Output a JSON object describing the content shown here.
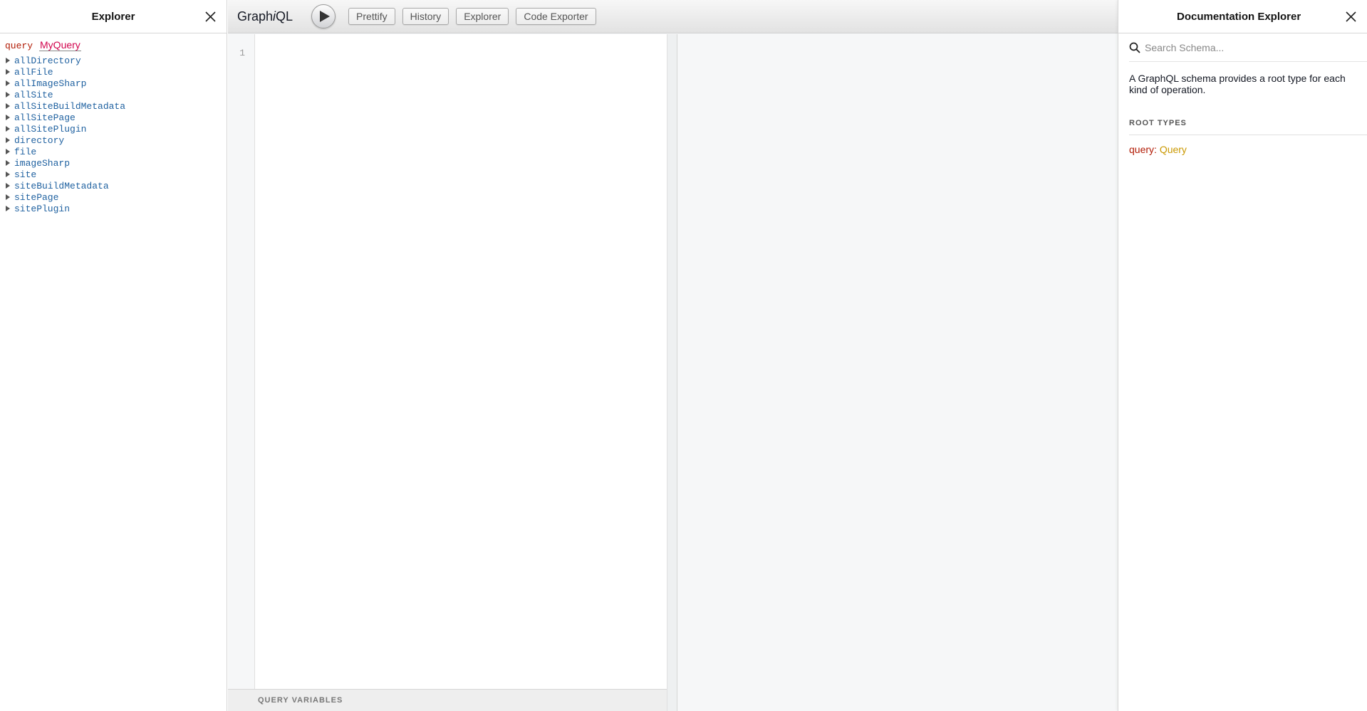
{
  "explorer": {
    "title": "Explorer",
    "operation": {
      "keyword": "query",
      "name": "MyQuery"
    },
    "fields": [
      "allDirectory",
      "allFile",
      "allImageSharp",
      "allSite",
      "allSiteBuildMetadata",
      "allSitePage",
      "allSitePlugin",
      "directory",
      "file",
      "imageSharp",
      "site",
      "siteBuildMetadata",
      "sitePage",
      "sitePlugin"
    ]
  },
  "toolbar": {
    "logo_prefix": "Graph",
    "logo_italic": "i",
    "logo_suffix": "QL",
    "buttons": [
      "Prettify",
      "History",
      "Explorer",
      "Code Exporter"
    ]
  },
  "editor": {
    "line_number": "1",
    "variables_title": "QUERY VARIABLES"
  },
  "docs": {
    "title": "Documentation Explorer",
    "search_placeholder": "Search Schema...",
    "description": "A GraphQL schema provides a root type for each kind of operation.",
    "section_title": "ROOT TYPES",
    "root_type_key": "query",
    "root_type_value": "Query"
  },
  "colors": {
    "keyword": "#b11a04",
    "field": "#1f61a0",
    "op_name": "#d2054e",
    "type": "#ca9800"
  }
}
